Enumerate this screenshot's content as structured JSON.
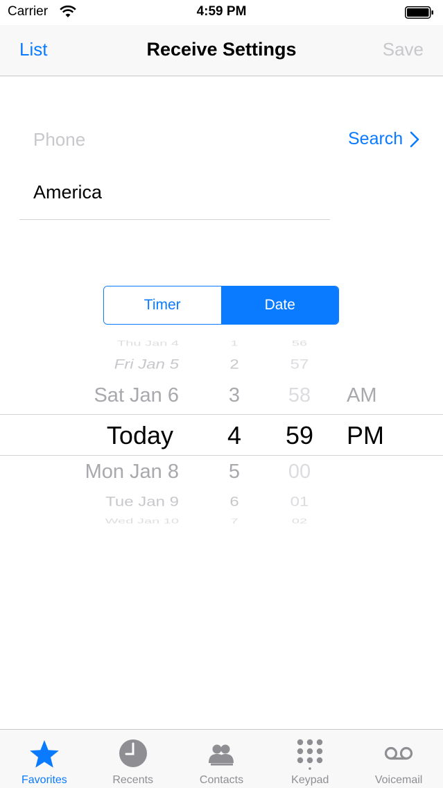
{
  "status_bar": {
    "carrier": "Carrier",
    "time": "4:59 PM"
  },
  "nav": {
    "left_label": "List",
    "title": "Receive Settings",
    "right_label": "Save"
  },
  "form": {
    "phone_placeholder": "Phone",
    "search_label": "Search",
    "country_value": "America"
  },
  "segments": [
    {
      "label": "Timer",
      "selected": false
    },
    {
      "label": "Date",
      "selected": true
    }
  ],
  "picker": {
    "day": [
      "Thu Jan 4",
      "Fri Jan 5",
      "Sat Jan 6",
      "Today",
      "Mon Jan 8",
      "Tue Jan 9",
      "Wed Jan 10"
    ],
    "hour": [
      "1",
      "2",
      "3",
      "4",
      "5",
      "6",
      "7"
    ],
    "minute": [
      "56",
      "57",
      "58",
      "59",
      "00",
      "01",
      "02"
    ],
    "ampm": [
      "AM",
      "PM"
    ]
  },
  "tabs": [
    {
      "label": "Favorites",
      "icon": "star-icon",
      "active": true
    },
    {
      "label": "Recents",
      "icon": "clock-icon",
      "active": false
    },
    {
      "label": "Contacts",
      "icon": "contacts-icon",
      "active": false
    },
    {
      "label": "Keypad",
      "icon": "keypad-icon",
      "active": false
    },
    {
      "label": "Voicemail",
      "icon": "voicemail-icon",
      "active": false
    }
  ],
  "colors": {
    "accent": "#0a7aff",
    "inactive": "#8e8e93",
    "placeholder": "#c7c7cc"
  }
}
